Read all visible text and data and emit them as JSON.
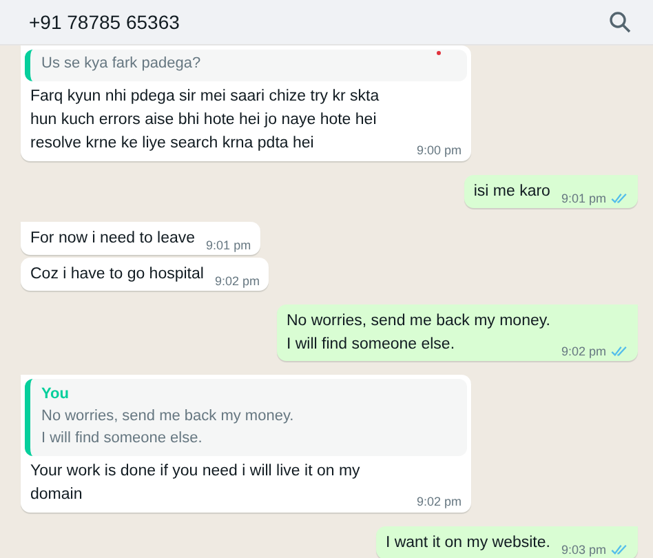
{
  "header": {
    "title": "+91 78785 65363"
  },
  "messages": [
    {
      "kind": "incoming",
      "quote": {
        "text": [
          "Us se kya fark padega?"
        ]
      },
      "text": "Farq kyun nhi pdega sir mei saari chize try kr skta hun kuch errors aise bhi hote hei jo naye hote hei resolve krne ke liye search krna pdta hei",
      "time": "9:00 pm"
    },
    {
      "kind": "outgoing",
      "text": "isi me karo",
      "time": "9:01 pm",
      "read": true
    },
    {
      "kind": "incoming",
      "text": "For now i need to leave",
      "time": "9:01 pm"
    },
    {
      "kind": "incoming",
      "text": "Coz i have to go hospital",
      "time": "9:02 pm"
    },
    {
      "kind": "outgoing",
      "text": "No worries, send me back my money.\nI will find someone else.",
      "time": "9:02 pm",
      "read": true
    },
    {
      "kind": "incoming",
      "quote": {
        "sender": "You",
        "text": [
          "No worries, send me back my money.",
          "I will find someone else."
        ]
      },
      "text": "Your work is done if you need i will live it on my domain",
      "time": "9:02 pm"
    },
    {
      "kind": "outgoing",
      "text": "I want it on my website.",
      "time": "9:03 pm",
      "read": true
    }
  ]
}
